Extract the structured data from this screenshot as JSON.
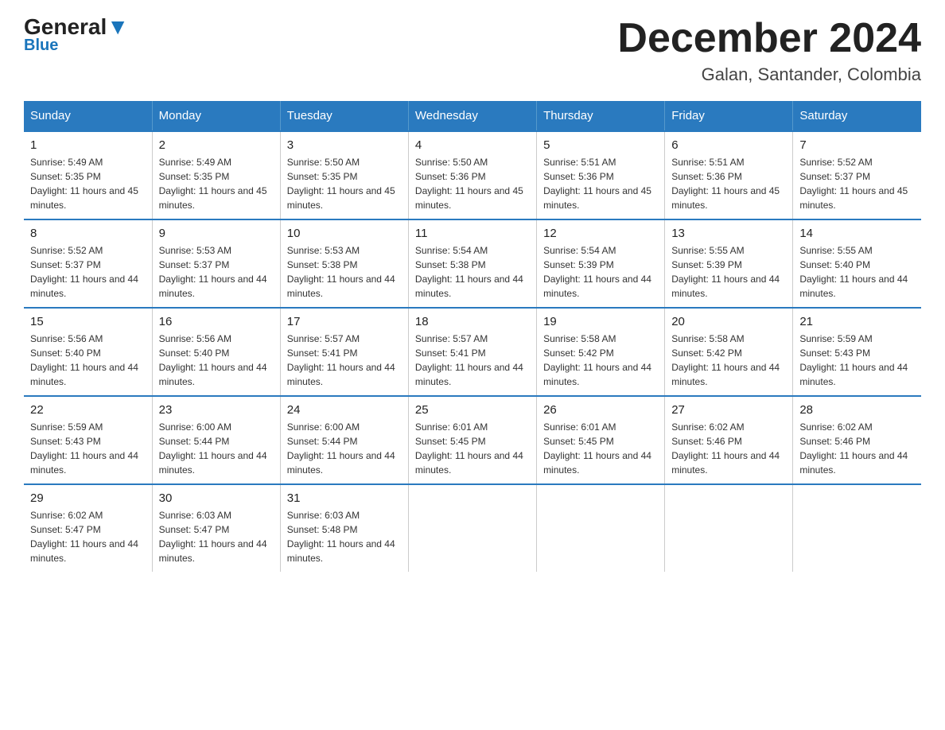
{
  "header": {
    "logo_general": "General",
    "logo_blue": "Blue",
    "title": "December 2024",
    "location": "Galan, Santander, Colombia"
  },
  "days_of_week": [
    "Sunday",
    "Monday",
    "Tuesday",
    "Wednesday",
    "Thursday",
    "Friday",
    "Saturday"
  ],
  "weeks": [
    [
      {
        "day": "1",
        "sunrise": "5:49 AM",
        "sunset": "5:35 PM",
        "daylight": "11 hours and 45 minutes."
      },
      {
        "day": "2",
        "sunrise": "5:49 AM",
        "sunset": "5:35 PM",
        "daylight": "11 hours and 45 minutes."
      },
      {
        "day": "3",
        "sunrise": "5:50 AM",
        "sunset": "5:35 PM",
        "daylight": "11 hours and 45 minutes."
      },
      {
        "day": "4",
        "sunrise": "5:50 AM",
        "sunset": "5:36 PM",
        "daylight": "11 hours and 45 minutes."
      },
      {
        "day": "5",
        "sunrise": "5:51 AM",
        "sunset": "5:36 PM",
        "daylight": "11 hours and 45 minutes."
      },
      {
        "day": "6",
        "sunrise": "5:51 AM",
        "sunset": "5:36 PM",
        "daylight": "11 hours and 45 minutes."
      },
      {
        "day": "7",
        "sunrise": "5:52 AM",
        "sunset": "5:37 PM",
        "daylight": "11 hours and 45 minutes."
      }
    ],
    [
      {
        "day": "8",
        "sunrise": "5:52 AM",
        "sunset": "5:37 PM",
        "daylight": "11 hours and 44 minutes."
      },
      {
        "day": "9",
        "sunrise": "5:53 AM",
        "sunset": "5:37 PM",
        "daylight": "11 hours and 44 minutes."
      },
      {
        "day": "10",
        "sunrise": "5:53 AM",
        "sunset": "5:38 PM",
        "daylight": "11 hours and 44 minutes."
      },
      {
        "day": "11",
        "sunrise": "5:54 AM",
        "sunset": "5:38 PM",
        "daylight": "11 hours and 44 minutes."
      },
      {
        "day": "12",
        "sunrise": "5:54 AM",
        "sunset": "5:39 PM",
        "daylight": "11 hours and 44 minutes."
      },
      {
        "day": "13",
        "sunrise": "5:55 AM",
        "sunset": "5:39 PM",
        "daylight": "11 hours and 44 minutes."
      },
      {
        "day": "14",
        "sunrise": "5:55 AM",
        "sunset": "5:40 PM",
        "daylight": "11 hours and 44 minutes."
      }
    ],
    [
      {
        "day": "15",
        "sunrise": "5:56 AM",
        "sunset": "5:40 PM",
        "daylight": "11 hours and 44 minutes."
      },
      {
        "day": "16",
        "sunrise": "5:56 AM",
        "sunset": "5:40 PM",
        "daylight": "11 hours and 44 minutes."
      },
      {
        "day": "17",
        "sunrise": "5:57 AM",
        "sunset": "5:41 PM",
        "daylight": "11 hours and 44 minutes."
      },
      {
        "day": "18",
        "sunrise": "5:57 AM",
        "sunset": "5:41 PM",
        "daylight": "11 hours and 44 minutes."
      },
      {
        "day": "19",
        "sunrise": "5:58 AM",
        "sunset": "5:42 PM",
        "daylight": "11 hours and 44 minutes."
      },
      {
        "day": "20",
        "sunrise": "5:58 AM",
        "sunset": "5:42 PM",
        "daylight": "11 hours and 44 minutes."
      },
      {
        "day": "21",
        "sunrise": "5:59 AM",
        "sunset": "5:43 PM",
        "daylight": "11 hours and 44 minutes."
      }
    ],
    [
      {
        "day": "22",
        "sunrise": "5:59 AM",
        "sunset": "5:43 PM",
        "daylight": "11 hours and 44 minutes."
      },
      {
        "day": "23",
        "sunrise": "6:00 AM",
        "sunset": "5:44 PM",
        "daylight": "11 hours and 44 minutes."
      },
      {
        "day": "24",
        "sunrise": "6:00 AM",
        "sunset": "5:44 PM",
        "daylight": "11 hours and 44 minutes."
      },
      {
        "day": "25",
        "sunrise": "6:01 AM",
        "sunset": "5:45 PM",
        "daylight": "11 hours and 44 minutes."
      },
      {
        "day": "26",
        "sunrise": "6:01 AM",
        "sunset": "5:45 PM",
        "daylight": "11 hours and 44 minutes."
      },
      {
        "day": "27",
        "sunrise": "6:02 AM",
        "sunset": "5:46 PM",
        "daylight": "11 hours and 44 minutes."
      },
      {
        "day": "28",
        "sunrise": "6:02 AM",
        "sunset": "5:46 PM",
        "daylight": "11 hours and 44 minutes."
      }
    ],
    [
      {
        "day": "29",
        "sunrise": "6:02 AM",
        "sunset": "5:47 PM",
        "daylight": "11 hours and 44 minutes."
      },
      {
        "day": "30",
        "sunrise": "6:03 AM",
        "sunset": "5:47 PM",
        "daylight": "11 hours and 44 minutes."
      },
      {
        "day": "31",
        "sunrise": "6:03 AM",
        "sunset": "5:48 PM",
        "daylight": "11 hours and 44 minutes."
      },
      null,
      null,
      null,
      null
    ]
  ]
}
